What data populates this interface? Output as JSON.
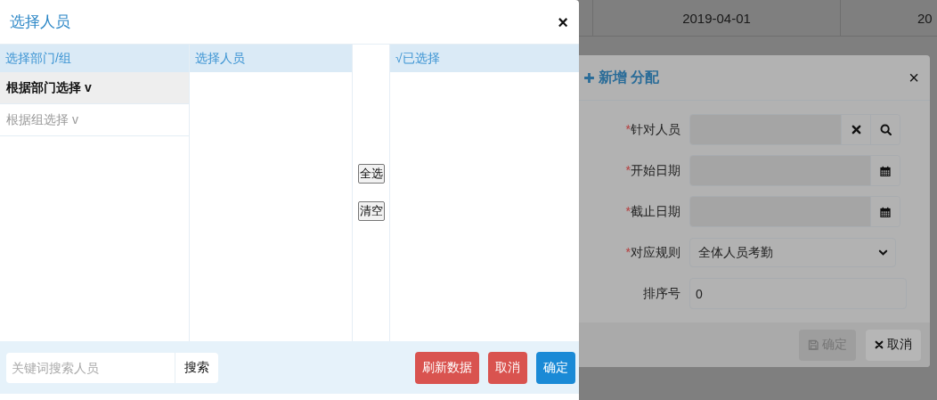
{
  "background_table": {
    "rows": [
      {
        "cells": [
          "2019-04-01",
          "20"
        ]
      }
    ]
  },
  "select_dialog": {
    "title": "选择人员",
    "close": "×",
    "columns": [
      {
        "heading": "选择部门/组"
      },
      {
        "heading": "选择人员"
      },
      {
        "heading": "√已选择"
      }
    ],
    "group_options": [
      {
        "label": "根据部门选择 v",
        "selected": true
      },
      {
        "label": "根据组选择 v",
        "selected": false
      }
    ],
    "middle_buttons": [
      "全选",
      "清空"
    ],
    "search": {
      "placeholder": "关键词搜索人员",
      "button": "搜索"
    },
    "buttons": [
      {
        "label": "刷新数据",
        "kind": "danger"
      },
      {
        "label": "取消",
        "kind": "danger"
      },
      {
        "label": "确定",
        "kind": "primary"
      }
    ]
  },
  "form_dialog": {
    "title": "新增 分配",
    "close": "×",
    "required_mark": "*",
    "fields": [
      {
        "label": "针对人员",
        "required": true,
        "kind": "lookup"
      },
      {
        "label": "开始日期",
        "required": true,
        "kind": "date"
      },
      {
        "label": "截止日期",
        "required": true,
        "kind": "date"
      },
      {
        "label": "对应规则",
        "required": true,
        "kind": "select",
        "value": "全体人员考勤"
      },
      {
        "label": "排序号",
        "required": false,
        "kind": "text",
        "value": "0"
      }
    ],
    "buttons": [
      {
        "label": "确定",
        "kind": "save",
        "disabled": true
      },
      {
        "label": "取消",
        "kind": "cancel",
        "disabled": false
      }
    ]
  }
}
